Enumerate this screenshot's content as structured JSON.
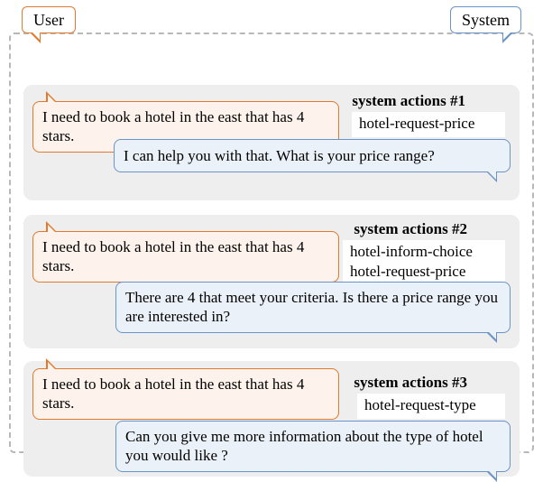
{
  "labels": {
    "user": "User",
    "system": "System"
  },
  "dialogues": [
    {
      "user_text": "I need to book a hotel in the east that has 4 stars.",
      "action_title": "system actions #1",
      "actions": [
        "hotel-request-price"
      ],
      "system_text": "I can help you with that. What is your price range?"
    },
    {
      "user_text": "I need to book a hotel in the east that has 4 stars.",
      "action_title": "system actions #2",
      "actions": [
        "hotel-inform-choice",
        "hotel-request-price"
      ],
      "system_text": "There are 4 that meet your criteria. Is there a price range you are interested in?"
    },
    {
      "user_text": "I need to book a hotel in the east that has 4 stars.",
      "action_title": "system actions #3",
      "actions": [
        "hotel-request-type"
      ],
      "system_text": "Can you give me more information about the type of hotel you would like ?"
    }
  ]
}
